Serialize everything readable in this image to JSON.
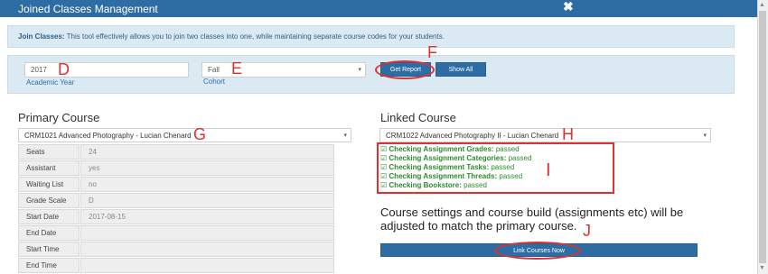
{
  "window": {
    "title": "Joined Classes Management",
    "close_glyph": "✖",
    "close_icon": "close-icon"
  },
  "info": {
    "label": "Join Classes:",
    "text": " This tool effectively allows you to join two classes into one, while maintaining separate course codes for your students."
  },
  "filters": {
    "year_value": "2017",
    "year_label": "Academic Year",
    "cohort_value": "Fall",
    "cohort_label": "Cohort",
    "get_report_label": "Get Report",
    "show_all_label": "Show All"
  },
  "primary": {
    "heading": "Primary Course",
    "selected_course": "CRM1021 Advanced Photography - Lucian Chenard",
    "details": [
      {
        "label": "Seats",
        "value": "24"
      },
      {
        "label": "Assistant",
        "value": "yes"
      },
      {
        "label": "Waiting List",
        "value": "no"
      },
      {
        "label": "Grade Scale",
        "value": "D"
      },
      {
        "label": "Start Date",
        "value": "2017-08-15"
      },
      {
        "label": "End Date",
        "value": ""
      },
      {
        "label": "Start Time",
        "value": ""
      },
      {
        "label": "End Time",
        "value": ""
      }
    ]
  },
  "linked": {
    "heading": "Linked Course",
    "selected_course": "CRM1022 Advanced Photography II - Lucian Chenard",
    "checks": [
      {
        "label": "Checking Assignment Grades:",
        "status": "passed"
      },
      {
        "label": "Checking Assignment Categories:",
        "status": "passed"
      },
      {
        "label": "Checking Assignment Tasks:",
        "status": "passed"
      },
      {
        "label": "Checking Assignment Threads:",
        "status": "passed"
      },
      {
        "label": "Checking Bookstore:",
        "status": "passed"
      }
    ],
    "check_icon": "check-square-icon",
    "note": "Course settings and course build (assignments etc) will be adjusted to match the primary course.",
    "link_button_label": "Link Courses Now"
  },
  "annotations": {
    "d": "D",
    "e": "E",
    "f": "F",
    "g": "G",
    "h": "H",
    "i": "I",
    "j": "J"
  },
  "colors": {
    "accent": "#2e6da4",
    "panel": "#dbe9f3",
    "passed": "#2e8b2e",
    "annotation": "#e03030"
  }
}
